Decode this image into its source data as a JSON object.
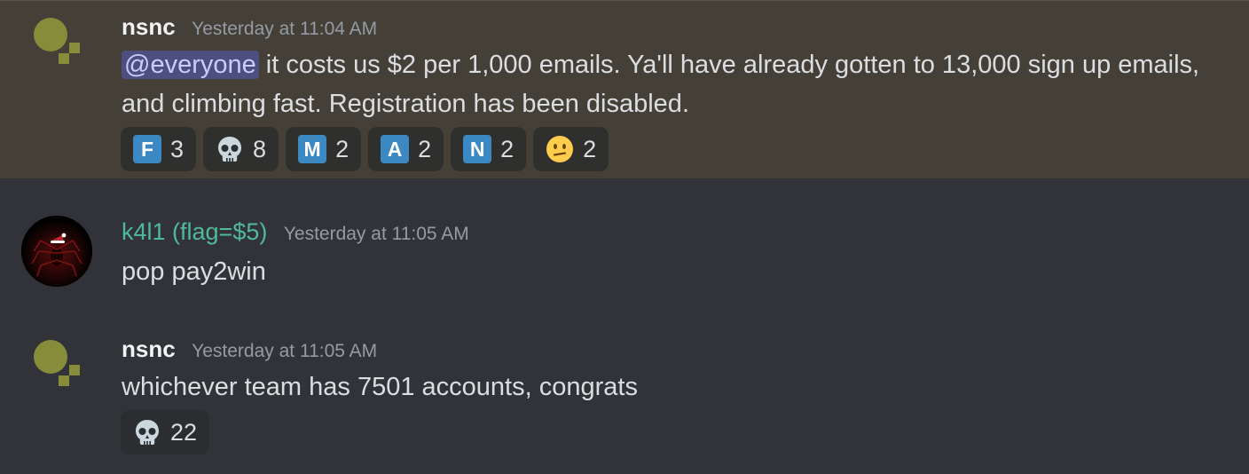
{
  "messages": [
    {
      "author": "nsnc",
      "timestamp": "Yesterday at 11:04 AM",
      "mention": "@everyone",
      "text": " it costs us $2 per 1,000 emails. Ya'll have already gotten to 13,000 sign up emails, and climbing fast. Registration has been disabled.",
      "reactions": [
        {
          "icon": "regional-indicator-f-icon",
          "glyph": "F",
          "count": "3"
        },
        {
          "icon": "skull-icon",
          "count": "8"
        },
        {
          "icon": "regional-indicator-m-icon",
          "glyph": "M",
          "count": "2"
        },
        {
          "icon": "regional-indicator-a-icon",
          "glyph": "A",
          "count": "2"
        },
        {
          "icon": "regional-indicator-n-icon",
          "glyph": "N",
          "count": "2"
        },
        {
          "icon": "confused-face-icon",
          "count": "2"
        }
      ]
    },
    {
      "author": "k4l1 (flag=$5)",
      "timestamp": "Yesterday at 11:05 AM",
      "text": "pop pay2win"
    },
    {
      "author": "nsnc",
      "timestamp": "Yesterday at 11:05 AM",
      "text": "whichever team has 7501 accounts, congrats",
      "reactions": [
        {
          "icon": "skull-icon",
          "count": "22"
        }
      ]
    }
  ],
  "colors": {
    "background": "#313338",
    "highlight_background": "#444038",
    "mention_bg": "#4d4f80",
    "username_green": "#4fba9a",
    "avatar_olive": "#868c3a"
  }
}
